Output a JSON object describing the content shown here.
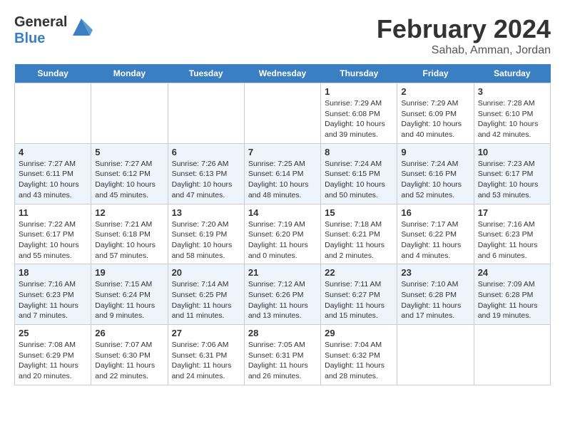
{
  "logo": {
    "text_general": "General",
    "text_blue": "Blue"
  },
  "title": {
    "month": "February 2024",
    "location": "Sahab, Amman, Jordan"
  },
  "headers": [
    "Sunday",
    "Monday",
    "Tuesday",
    "Wednesday",
    "Thursday",
    "Friday",
    "Saturday"
  ],
  "weeks": [
    [
      {
        "day": "",
        "sunrise": "",
        "sunset": "",
        "daylight": "",
        "empty": true
      },
      {
        "day": "",
        "sunrise": "",
        "sunset": "",
        "daylight": "",
        "empty": true
      },
      {
        "day": "",
        "sunrise": "",
        "sunset": "",
        "daylight": "",
        "empty": true
      },
      {
        "day": "",
        "sunrise": "",
        "sunset": "",
        "daylight": "",
        "empty": true
      },
      {
        "day": "1",
        "sunrise": "7:29 AM",
        "sunset": "6:08 PM",
        "daylight": "10 hours and 39 minutes.",
        "empty": false
      },
      {
        "day": "2",
        "sunrise": "7:29 AM",
        "sunset": "6:09 PM",
        "daylight": "10 hours and 40 minutes.",
        "empty": false
      },
      {
        "day": "3",
        "sunrise": "7:28 AM",
        "sunset": "6:10 PM",
        "daylight": "10 hours and 42 minutes.",
        "empty": false
      }
    ],
    [
      {
        "day": "4",
        "sunrise": "7:27 AM",
        "sunset": "6:11 PM",
        "daylight": "10 hours and 43 minutes.",
        "empty": false
      },
      {
        "day": "5",
        "sunrise": "7:27 AM",
        "sunset": "6:12 PM",
        "daylight": "10 hours and 45 minutes.",
        "empty": false
      },
      {
        "day": "6",
        "sunrise": "7:26 AM",
        "sunset": "6:13 PM",
        "daylight": "10 hours and 47 minutes.",
        "empty": false
      },
      {
        "day": "7",
        "sunrise": "7:25 AM",
        "sunset": "6:14 PM",
        "daylight": "10 hours and 48 minutes.",
        "empty": false
      },
      {
        "day": "8",
        "sunrise": "7:24 AM",
        "sunset": "6:15 PM",
        "daylight": "10 hours and 50 minutes.",
        "empty": false
      },
      {
        "day": "9",
        "sunrise": "7:24 AM",
        "sunset": "6:16 PM",
        "daylight": "10 hours and 52 minutes.",
        "empty": false
      },
      {
        "day": "10",
        "sunrise": "7:23 AM",
        "sunset": "6:17 PM",
        "daylight": "10 hours and 53 minutes.",
        "empty": false
      }
    ],
    [
      {
        "day": "11",
        "sunrise": "7:22 AM",
        "sunset": "6:17 PM",
        "daylight": "10 hours and 55 minutes.",
        "empty": false
      },
      {
        "day": "12",
        "sunrise": "7:21 AM",
        "sunset": "6:18 PM",
        "daylight": "10 hours and 57 minutes.",
        "empty": false
      },
      {
        "day": "13",
        "sunrise": "7:20 AM",
        "sunset": "6:19 PM",
        "daylight": "10 hours and 58 minutes.",
        "empty": false
      },
      {
        "day": "14",
        "sunrise": "7:19 AM",
        "sunset": "6:20 PM",
        "daylight": "11 hours and 0 minutes.",
        "empty": false
      },
      {
        "day": "15",
        "sunrise": "7:18 AM",
        "sunset": "6:21 PM",
        "daylight": "11 hours and 2 minutes.",
        "empty": false
      },
      {
        "day": "16",
        "sunrise": "7:17 AM",
        "sunset": "6:22 PM",
        "daylight": "11 hours and 4 minutes.",
        "empty": false
      },
      {
        "day": "17",
        "sunrise": "7:16 AM",
        "sunset": "6:23 PM",
        "daylight": "11 hours and 6 minutes.",
        "empty": false
      }
    ],
    [
      {
        "day": "18",
        "sunrise": "7:16 AM",
        "sunset": "6:23 PM",
        "daylight": "11 hours and 7 minutes.",
        "empty": false
      },
      {
        "day": "19",
        "sunrise": "7:15 AM",
        "sunset": "6:24 PM",
        "daylight": "11 hours and 9 minutes.",
        "empty": false
      },
      {
        "day": "20",
        "sunrise": "7:14 AM",
        "sunset": "6:25 PM",
        "daylight": "11 hours and 11 minutes.",
        "empty": false
      },
      {
        "day": "21",
        "sunrise": "7:12 AM",
        "sunset": "6:26 PM",
        "daylight": "11 hours and 13 minutes.",
        "empty": false
      },
      {
        "day": "22",
        "sunrise": "7:11 AM",
        "sunset": "6:27 PM",
        "daylight": "11 hours and 15 minutes.",
        "empty": false
      },
      {
        "day": "23",
        "sunrise": "7:10 AM",
        "sunset": "6:28 PM",
        "daylight": "11 hours and 17 minutes.",
        "empty": false
      },
      {
        "day": "24",
        "sunrise": "7:09 AM",
        "sunset": "6:28 PM",
        "daylight": "11 hours and 19 minutes.",
        "empty": false
      }
    ],
    [
      {
        "day": "25",
        "sunrise": "7:08 AM",
        "sunset": "6:29 PM",
        "daylight": "11 hours and 20 minutes.",
        "empty": false
      },
      {
        "day": "26",
        "sunrise": "7:07 AM",
        "sunset": "6:30 PM",
        "daylight": "11 hours and 22 minutes.",
        "empty": false
      },
      {
        "day": "27",
        "sunrise": "7:06 AM",
        "sunset": "6:31 PM",
        "daylight": "11 hours and 24 minutes.",
        "empty": false
      },
      {
        "day": "28",
        "sunrise": "7:05 AM",
        "sunset": "6:31 PM",
        "daylight": "11 hours and 26 minutes.",
        "empty": false
      },
      {
        "day": "29",
        "sunrise": "7:04 AM",
        "sunset": "6:32 PM",
        "daylight": "11 hours and 28 minutes.",
        "empty": false
      },
      {
        "day": "",
        "sunrise": "",
        "sunset": "",
        "daylight": "",
        "empty": true
      },
      {
        "day": "",
        "sunrise": "",
        "sunset": "",
        "daylight": "",
        "empty": true
      }
    ]
  ],
  "labels": {
    "sunrise": "Sunrise:",
    "sunset": "Sunset:",
    "daylight": "Daylight:"
  }
}
